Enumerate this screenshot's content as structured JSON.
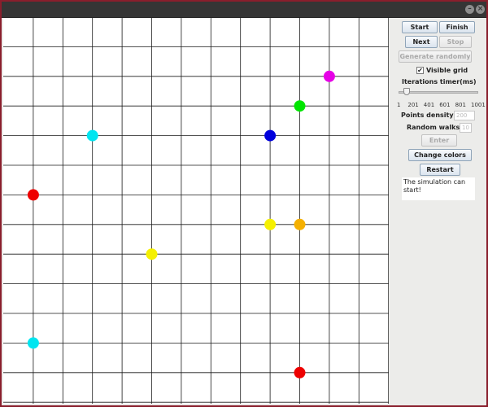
{
  "colors": {
    "window_bg": "#ececea",
    "titlebar": "#353535",
    "canvas_bg": "#ffffff",
    "grid_line": "#1a1a1a",
    "desktop": "#8a1e2c"
  },
  "titlebar": {
    "buttons": [
      "minimize-icon",
      "close-icon"
    ]
  },
  "canvas": {
    "grid": {
      "columns": 13,
      "rows": 13
    },
    "points": [
      {
        "col": 11,
        "row": 2,
        "color": "#e600e6"
      },
      {
        "col": 10,
        "row": 3,
        "color": "#00e600"
      },
      {
        "col": 3,
        "row": 4,
        "color": "#00e5f0"
      },
      {
        "col": 9,
        "row": 4,
        "color": "#0000dd"
      },
      {
        "col": 1,
        "row": 6,
        "color": "#ee0000"
      },
      {
        "col": 9,
        "row": 7,
        "color": "#f5f000"
      },
      {
        "col": 10,
        "row": 7,
        "color": "#f5b000"
      },
      {
        "col": 5,
        "row": 8,
        "color": "#f5f000"
      },
      {
        "col": 1,
        "row": 11,
        "color": "#00e5f0"
      },
      {
        "col": 10,
        "row": 12,
        "color": "#ee0000"
      }
    ]
  },
  "panel": {
    "start_label": "Start",
    "finish_label": "Finish",
    "next_label": "Next",
    "stop_label": "Stop",
    "generate_label": "Generate randomly",
    "visible_grid_label": "Visible grid",
    "visible_grid_checked": true,
    "visible_grid_mark": "✔",
    "timer_label": "Iterations timer(ms)",
    "timer_ticks": [
      "1",
      "201",
      "401",
      "601",
      "801",
      "1001"
    ],
    "timer_value": 1,
    "density_label": "Points density:",
    "density_value": "200",
    "walks_label": "Random walks:",
    "walks_value": "10",
    "enter_label": "Enter",
    "change_colors_label": "Change colors",
    "restart_label": "Restart",
    "status_text": "The simulation can start!"
  }
}
